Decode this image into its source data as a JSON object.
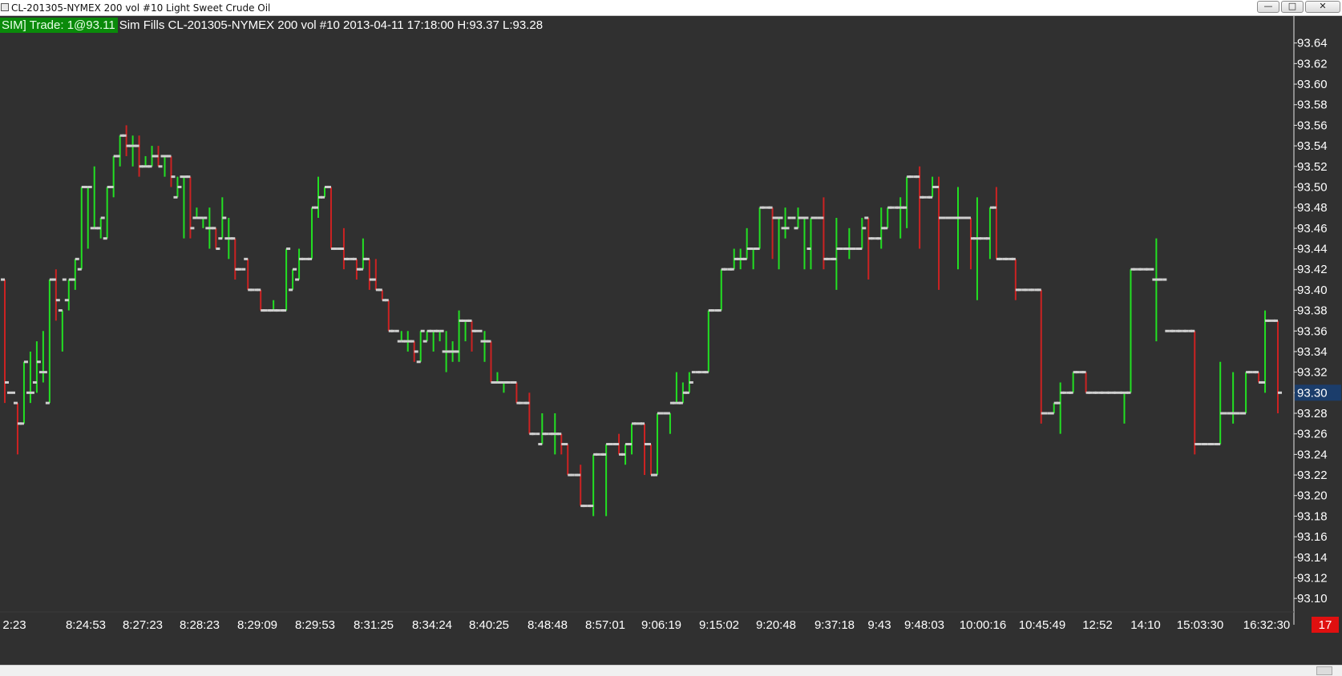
{
  "window": {
    "title": "CL-201305-NYMEX  200 vol  #10  Light Sweet Crude Oil",
    "minimize_label": "—",
    "maximize_label": "□",
    "close_label": "✕"
  },
  "status": {
    "trade_badge": "SIM]  Trade: 1@93.11",
    "info": "Sim Fills  CL-201305-NYMEX  200 vol  #10 2013-04-11 17:18:00 H:93.37 L:93.28"
  },
  "colors": {
    "background": "#303030",
    "up": "#22e022",
    "down": "#cc2222",
    "tick": "#cfcfcf",
    "badge": "#0a8a0a",
    "price_marker": "#1b3d6b",
    "count_badge": "#e01010"
  },
  "price_marker": {
    "value": "93.30",
    "price": 93.3
  },
  "bar_count": "17",
  "chart_data": {
    "type": "ohlc",
    "y_axis": {
      "min": 93.09,
      "max": 93.66,
      "tick_step": 0.02,
      "tick_start": 93.1,
      "tick_end": 93.64,
      "position": "right"
    },
    "x_labels": [
      "2:23",
      "8:24:53",
      "8:27:23",
      "8:28:23",
      "8:29:09",
      "8:29:53",
      "8:31:25",
      "8:34:24",
      "8:40:25",
      "8:48:48",
      "8:57:01",
      "9:06:19",
      "9:15:02",
      "9:20:48",
      "9:37:18",
      "9:43",
      "9:48:03",
      "10:00:16",
      "10:45:49",
      "12:52",
      "14:10",
      "15:03:30",
      "16:32:30"
    ],
    "bars": [
      [
        93.41,
        93.41,
        93.29,
        93.31
      ],
      [
        93.3,
        93.3,
        93.3,
        93.3
      ],
      [
        93.29,
        93.29,
        93.24,
        93.27
      ],
      [
        93.27,
        93.33,
        93.27,
        93.33
      ],
      [
        93.3,
        93.34,
        93.29,
        93.3
      ],
      [
        93.31,
        93.35,
        93.3,
        93.33
      ],
      [
        93.32,
        93.36,
        93.31,
        93.32
      ],
      [
        93.29,
        93.41,
        93.29,
        93.41
      ],
      [
        93.41,
        93.42,
        93.37,
        93.39
      ],
      [
        93.38,
        93.38,
        93.34,
        93.41
      ],
      [
        93.39,
        93.41,
        93.38,
        93.41
      ],
      [
        93.41,
        93.43,
        93.4,
        93.43
      ],
      [
        93.42,
        93.5,
        93.42,
        93.5
      ],
      [
        93.5,
        93.5,
        93.44,
        93.5
      ],
      [
        93.46,
        93.52,
        93.46,
        93.46
      ],
      [
        93.46,
        93.47,
        93.45,
        93.47
      ],
      [
        93.45,
        93.5,
        93.45,
        93.5
      ],
      [
        93.5,
        93.53,
        93.49,
        93.53
      ],
      [
        93.53,
        93.55,
        93.52,
        93.55
      ],
      [
        93.55,
        93.56,
        93.53,
        93.54
      ],
      [
        93.54,
        93.55,
        93.52,
        93.54
      ],
      [
        93.54,
        93.55,
        93.51,
        93.52
      ],
      [
        93.52,
        93.53,
        93.52,
        93.52
      ],
      [
        93.52,
        93.54,
        93.52,
        93.53
      ],
      [
        93.53,
        93.54,
        93.52,
        93.52
      ],
      [
        93.53,
        93.53,
        93.51,
        93.53
      ],
      [
        93.53,
        93.53,
        93.5,
        93.51
      ],
      [
        93.49,
        93.51,
        93.49,
        93.5
      ],
      [
        93.51,
        93.51,
        93.45,
        93.51
      ],
      [
        93.51,
        93.51,
        93.45,
        93.46
      ],
      [
        93.47,
        93.48,
        93.47,
        93.47
      ],
      [
        93.47,
        93.47,
        93.46,
        93.47
      ],
      [
        93.46,
        93.48,
        93.44,
        93.46
      ],
      [
        93.46,
        93.46,
        93.44,
        93.44
      ],
      [
        93.45,
        93.49,
        93.45,
        93.47
      ],
      [
        93.45,
        93.47,
        93.43,
        93.45
      ],
      [
        93.45,
        93.45,
        93.41,
        93.42
      ],
      [
        93.42,
        93.42,
        93.42,
        93.42
      ],
      [
        93.43,
        93.43,
        93.4,
        93.4
      ],
      [
        93.4,
        93.4,
        93.4,
        93.4
      ],
      [
        93.4,
        93.4,
        93.38,
        93.38
      ],
      [
        93.38,
        93.38,
        93.38,
        93.38
      ],
      [
        93.38,
        93.39,
        93.38,
        93.38
      ],
      [
        93.38,
        93.38,
        93.38,
        93.38
      ],
      [
        93.38,
        93.44,
        93.38,
        93.44
      ],
      [
        93.4,
        93.42,
        93.4,
        93.42
      ],
      [
        93.41,
        93.44,
        93.41,
        93.43
      ],
      [
        93.43,
        93.43,
        93.43,
        93.43
      ],
      [
        93.43,
        93.48,
        93.43,
        93.48
      ],
      [
        93.48,
        93.51,
        93.47,
        93.49
      ],
      [
        93.49,
        93.5,
        93.49,
        93.5
      ],
      [
        93.5,
        93.5,
        93.44,
        93.44
      ],
      [
        93.44,
        93.44,
        93.44,
        93.44
      ],
      [
        93.44,
        93.46,
        93.42,
        93.43
      ],
      [
        93.43,
        93.43,
        93.43,
        93.43
      ],
      [
        93.43,
        93.43,
        93.41,
        93.42
      ],
      [
        93.42,
        93.45,
        93.42,
        93.43
      ],
      [
        93.43,
        93.43,
        93.4,
        93.41
      ],
      [
        93.41,
        93.43,
        93.4,
        93.4
      ],
      [
        93.4,
        93.4,
        93.39,
        93.39
      ],
      [
        93.39,
        93.39,
        93.36,
        93.36
      ],
      [
        93.36,
        93.36,
        93.36,
        93.36
      ],
      [
        93.35,
        93.36,
        93.35,
        93.35
      ],
      [
        93.35,
        93.36,
        93.34,
        93.35
      ],
      [
        93.35,
        93.35,
        93.33,
        93.34
      ],
      [
        93.33,
        93.36,
        93.33,
        93.36
      ],
      [
        93.35,
        93.36,
        93.35,
        93.36
      ],
      [
        93.36,
        93.36,
        93.34,
        93.36
      ],
      [
        93.36,
        93.36,
        93.35,
        93.36
      ],
      [
        93.34,
        93.36,
        93.32,
        93.34
      ],
      [
        93.34,
        93.35,
        93.33,
        93.34
      ],
      [
        93.34,
        93.38,
        93.33,
        93.37
      ],
      [
        93.37,
        93.37,
        93.35,
        93.37
      ],
      [
        93.37,
        93.37,
        93.34,
        93.36
      ],
      [
        93.36,
        93.36,
        93.36,
        93.36
      ],
      [
        93.35,
        93.36,
        93.33,
        93.35
      ],
      [
        93.35,
        93.35,
        93.31,
        93.31
      ],
      [
        93.31,
        93.32,
        93.31,
        93.31
      ],
      [
        93.31,
        93.31,
        93.3,
        93.31
      ],
      [
        93.31,
        93.31,
        93.31,
        93.31
      ],
      [
        93.31,
        93.31,
        93.29,
        93.29
      ],
      [
        93.29,
        93.29,
        93.29,
        93.29
      ],
      [
        93.29,
        93.3,
        93.26,
        93.26
      ],
      [
        93.26,
        93.26,
        93.26,
        93.26
      ],
      [
        93.25,
        93.28,
        93.25,
        93.26
      ],
      [
        93.26,
        93.26,
        93.26,
        93.26
      ],
      [
        93.26,
        93.28,
        93.24,
        93.26
      ],
      [
        93.26,
        93.26,
        93.24,
        93.25
      ],
      [
        93.25,
        93.25,
        93.22,
        93.22
      ],
      [
        93.22,
        93.22,
        93.22,
        93.22
      ],
      [
        93.22,
        93.23,
        93.19,
        93.19
      ],
      [
        93.19,
        93.19,
        93.19,
        93.19
      ],
      [
        93.19,
        93.24,
        93.18,
        93.24
      ],
      [
        93.24,
        93.24,
        93.24,
        93.24
      ],
      [
        93.24,
        93.25,
        93.18,
        93.25
      ],
      [
        93.25,
        93.25,
        93.25,
        93.25
      ],
      [
        93.25,
        93.26,
        93.24,
        93.24
      ],
      [
        93.24,
        93.25,
        93.23,
        93.25
      ],
      [
        93.25,
        93.27,
        93.24,
        93.27
      ],
      [
        93.27,
        93.27,
        93.27,
        93.27
      ],
      [
        93.27,
        93.27,
        93.22,
        93.25
      ],
      [
        93.25,
        93.25,
        93.22,
        93.22
      ],
      [
        93.22,
        93.28,
        93.22,
        93.28
      ],
      [
        93.28,
        93.28,
        93.28,
        93.28
      ],
      [
        93.28,
        93.28,
        93.26,
        93.29
      ],
      [
        93.29,
        93.32,
        93.29,
        93.29
      ],
      [
        93.29,
        93.31,
        93.29,
        93.3
      ],
      [
        93.3,
        93.32,
        93.3,
        93.31
      ],
      [
        93.32,
        93.32,
        93.32,
        93.32
      ],
      [
        93.32,
        93.32,
        93.32,
        93.32
      ],
      [
        93.32,
        93.38,
        93.32,
        93.38
      ],
      [
        93.38,
        93.38,
        93.38,
        93.38
      ],
      [
        93.38,
        93.42,
        93.38,
        93.42
      ],
      [
        93.42,
        93.42,
        93.42,
        93.42
      ],
      [
        93.42,
        93.44,
        93.42,
        93.43
      ],
      [
        93.43,
        93.44,
        93.42,
        93.43
      ],
      [
        93.43,
        93.46,
        93.43,
        93.44
      ],
      [
        93.44,
        93.44,
        93.42,
        93.44
      ],
      [
        93.44,
        93.48,
        93.44,
        93.48
      ],
      [
        93.48,
        93.48,
        93.48,
        93.48
      ],
      [
        93.48,
        93.48,
        93.43,
        93.47
      ],
      [
        93.47,
        93.47,
        93.42,
        93.47
      ],
      [
        93.46,
        93.48,
        93.45,
        93.46
      ],
      [
        93.47,
        93.47,
        93.47,
        93.47
      ],
      [
        93.46,
        93.48,
        93.46,
        93.47
      ],
      [
        93.47,
        93.47,
        93.42,
        93.47
      ],
      [
        93.44,
        93.47,
        93.42,
        93.47
      ],
      [
        93.47,
        93.47,
        93.47,
        93.47
      ],
      [
        93.47,
        93.49,
        93.42,
        93.43
      ],
      [
        93.43,
        93.43,
        93.43,
        93.43
      ],
      [
        93.43,
        93.47,
        93.4,
        93.44
      ],
      [
        93.44,
        93.44,
        93.44,
        93.44
      ],
      [
        93.44,
        93.46,
        93.43,
        93.44
      ],
      [
        93.44,
        93.44,
        93.44,
        93.44
      ],
      [
        93.44,
        93.47,
        93.44,
        93.46
      ],
      [
        93.47,
        93.47,
        93.41,
        93.45
      ],
      [
        93.45,
        93.45,
        93.45,
        93.45
      ],
      [
        93.45,
        93.48,
        93.44,
        93.46
      ],
      [
        93.46,
        93.48,
        93.46,
        93.48
      ],
      [
        93.48,
        93.48,
        93.48,
        93.48
      ],
      [
        93.48,
        93.49,
        93.45,
        93.48
      ],
      [
        93.48,
        93.51,
        93.46,
        93.51
      ],
      [
        93.51,
        93.51,
        93.51,
        93.51
      ],
      [
        93.51,
        93.52,
        93.44,
        93.49
      ],
      [
        93.49,
        93.49,
        93.49,
        93.49
      ],
      [
        93.49,
        93.51,
        93.49,
        93.5
      ],
      [
        93.5,
        93.51,
        93.4,
        93.47
      ],
      [
        93.47,
        93.47,
        93.47,
        93.47
      ],
      [
        93.47,
        93.47,
        93.47,
        93.47
      ],
      [
        93.47,
        93.5,
        93.42,
        93.47
      ],
      [
        93.47,
        93.47,
        93.47,
        93.47
      ],
      [
        93.47,
        93.47,
        93.42,
        93.45
      ],
      [
        93.45,
        93.49,
        93.39,
        93.45
      ],
      [
        93.45,
        93.45,
        93.45,
        93.45
      ],
      [
        93.45,
        93.48,
        93.43,
        93.48
      ],
      [
        93.48,
        93.5,
        93.43,
        93.43
      ],
      [
        93.43,
        93.43,
        93.43,
        93.43
      ],
      [
        93.43,
        93.43,
        93.43,
        93.43
      ],
      [
        93.43,
        93.43,
        93.39,
        93.4
      ],
      [
        93.4,
        93.4,
        93.4,
        93.4
      ],
      [
        93.4,
        93.4,
        93.4,
        93.4
      ],
      [
        93.4,
        93.4,
        93.4,
        93.4
      ],
      [
        93.4,
        93.4,
        93.27,
        93.28
      ],
      [
        93.28,
        93.28,
        93.28,
        93.28
      ],
      [
        93.28,
        93.29,
        93.28,
        93.29
      ],
      [
        93.29,
        93.31,
        93.26,
        93.3
      ],
      [
        93.3,
        93.3,
        93.3,
        93.3
      ],
      [
        93.3,
        93.32,
        93.3,
        93.32
      ],
      [
        93.32,
        93.32,
        93.32,
        93.32
      ],
      [
        93.32,
        93.32,
        93.3,
        93.3
      ],
      [
        93.3,
        93.3,
        93.3,
        93.3
      ],
      [
        93.3,
        93.3,
        93.3,
        93.3
      ],
      [
        93.3,
        93.3,
        93.3,
        93.3
      ],
      [
        93.3,
        93.3,
        93.3,
        93.3
      ],
      [
        93.3,
        93.3,
        93.3,
        93.3
      ],
      [
        93.3,
        93.3,
        93.27,
        93.3
      ],
      [
        93.3,
        93.42,
        93.3,
        93.42
      ],
      [
        93.42,
        93.42,
        93.42,
        93.42
      ],
      [
        93.42,
        93.42,
        93.42,
        93.42
      ],
      [
        93.42,
        93.42,
        93.42,
        93.42
      ],
      [
        93.41,
        93.45,
        93.35,
        93.41
      ],
      [
        93.41,
        93.41,
        93.41,
        93.41
      ],
      [
        93.36,
        93.36,
        93.36,
        93.36
      ],
      [
        93.36,
        93.36,
        93.36,
        93.36
      ],
      [
        93.36,
        93.36,
        93.36,
        93.36
      ],
      [
        93.36,
        93.36,
        93.36,
        93.36
      ],
      [
        93.36,
        93.36,
        93.24,
        93.25
      ],
      [
        93.25,
        93.25,
        93.25,
        93.25
      ],
      [
        93.25,
        93.25,
        93.25,
        93.25
      ],
      [
        93.25,
        93.25,
        93.25,
        93.25
      ],
      [
        93.25,
        93.33,
        93.25,
        93.28
      ],
      [
        93.28,
        93.28,
        93.28,
        93.28
      ],
      [
        93.28,
        93.32,
        93.27,
        93.28
      ],
      [
        93.28,
        93.28,
        93.28,
        93.28
      ],
      [
        93.28,
        93.32,
        93.28,
        93.32
      ],
      [
        93.32,
        93.32,
        93.32,
        93.32
      ],
      [
        93.32,
        93.32,
        93.31,
        93.31
      ],
      [
        93.31,
        93.38,
        93.3,
        93.37
      ],
      [
        93.37,
        93.37,
        93.37,
        93.37
      ],
      [
        93.37,
        93.37,
        93.28,
        93.3
      ]
    ]
  }
}
